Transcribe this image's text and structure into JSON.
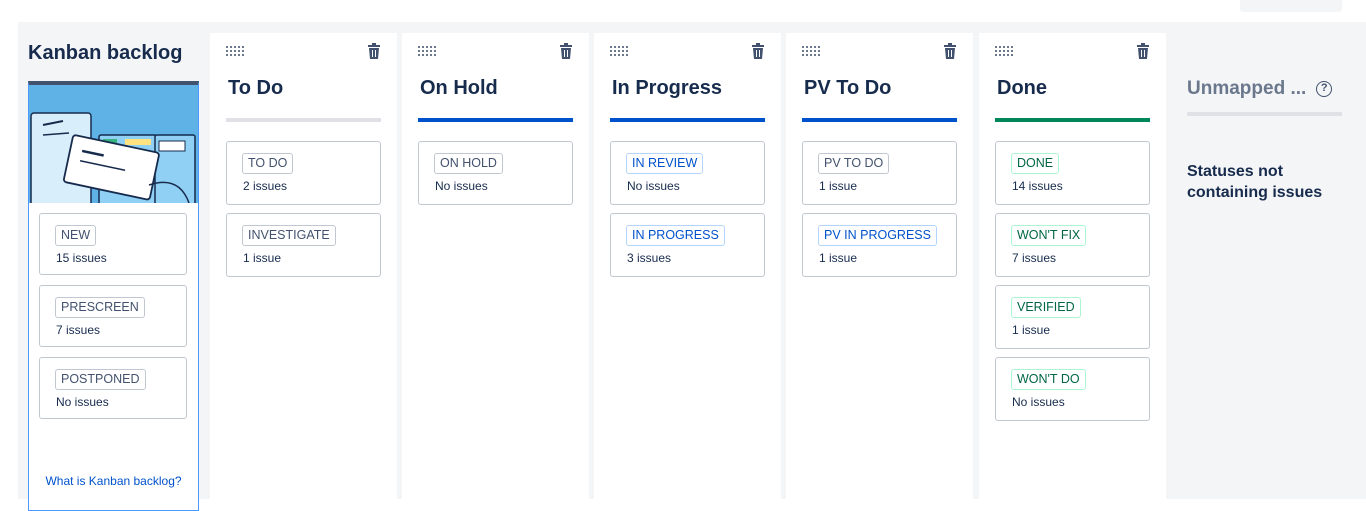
{
  "backlog": {
    "title": "Kanban backlog",
    "link": "What is Kanban backlog?",
    "cards": [
      {
        "status": "NEW",
        "count": "15 issues"
      },
      {
        "status": "PRESCREEN",
        "count": "7 issues"
      },
      {
        "status": "POSTPONED",
        "count": "No issues"
      }
    ]
  },
  "columns": [
    {
      "title": "To Do",
      "bar_color": "#dfe1e6",
      "cards": [
        {
          "status": "TO DO",
          "count": "2 issues"
        },
        {
          "status": "INVESTIGATE",
          "count": "1 issue"
        }
      ]
    },
    {
      "title": "On Hold",
      "bar_color": "#0052cc",
      "cards": [
        {
          "status": "ON HOLD",
          "count": "No issues"
        }
      ]
    },
    {
      "title": "In Progress",
      "bar_color": "#0052cc",
      "cards": [
        {
          "status": "IN REVIEW",
          "count": "No issues"
        },
        {
          "status": "IN PROGRESS",
          "count": "3 issues"
        }
      ]
    },
    {
      "title": "PV To Do",
      "bar_color": "#0052cc",
      "cards": [
        {
          "status": "PV TO DO",
          "count": "1 issue"
        },
        {
          "status": "PV IN PROGRESS",
          "count": "1 issue"
        }
      ]
    },
    {
      "title": "Done",
      "bar_color": "#00875a",
      "cards": [
        {
          "status": "DONE",
          "count": "14 issues"
        },
        {
          "status": "WON'T FIX",
          "count": "7 issues"
        },
        {
          "status": "VERIFIED",
          "count": "1 issue"
        },
        {
          "status": "WON'T DO",
          "count": "No issues"
        }
      ]
    }
  ],
  "unmapped": {
    "title": "Unmapped ...",
    "help_icon": "?",
    "empty_text": "Statuses not containing issues"
  },
  "colors": {
    "blue": "#0052cc",
    "green": "#00875a",
    "gray_bar": "#dfe1e6",
    "backlog_accent": "#4c9aff"
  },
  "icons": [
    "drag-handle-icon",
    "trash-icon",
    "help-icon"
  ]
}
